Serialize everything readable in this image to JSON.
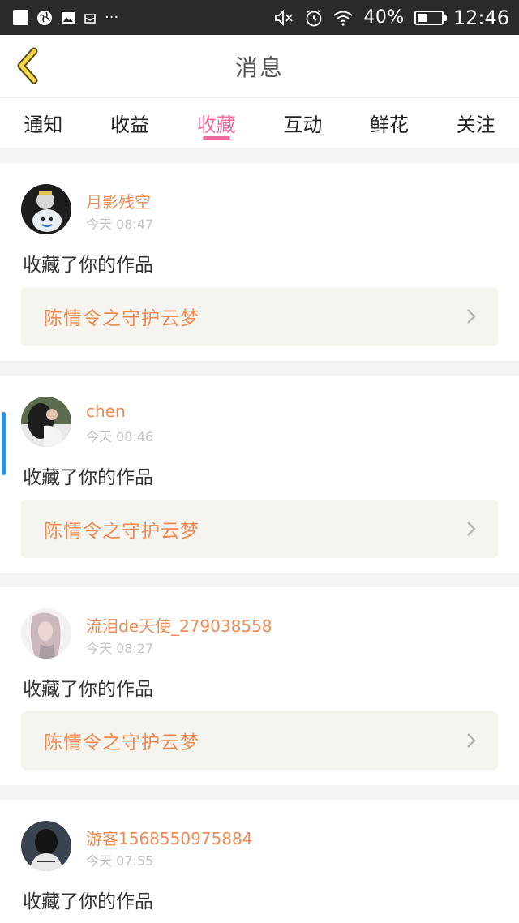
{
  "status_bar": {
    "battery_percent": "40%",
    "battery_level": 0.4,
    "time": "12:46",
    "icons": [
      "square-icon",
      "globe-icon",
      "image-icon",
      "mail-icon",
      "more-icon",
      "mute-icon",
      "alarm-icon",
      "wifi-icon",
      "battery-icon"
    ]
  },
  "nav": {
    "title": "消息"
  },
  "tabs": [
    {
      "label": "通知",
      "active": false
    },
    {
      "label": "收益",
      "active": false
    },
    {
      "label": "收藏",
      "active": true
    },
    {
      "label": "互动",
      "active": false
    },
    {
      "label": "鲜花",
      "active": false
    },
    {
      "label": "关注",
      "active": false
    }
  ],
  "messages": [
    {
      "username": "月影残空",
      "time": "今天 08:47",
      "text": "收藏了你的作品",
      "work_title": "陈情令之守护云梦"
    },
    {
      "username": "chen",
      "time": "今天 08:46",
      "text": "收藏了你的作品",
      "work_title": "陈情令之守护云梦"
    },
    {
      "username": "流泪de天使_279038558",
      "time": "今天 08:27",
      "text": "收藏了你的作品",
      "work_title": "陈情令之守护云梦"
    },
    {
      "username": "游客1568550975884",
      "time": "今天 07:55",
      "text": "收藏了你的作品"
    }
  ],
  "colors": {
    "accent_pink": "#ee6b9e",
    "name_orange": "#ee8a55",
    "statusbar": "#2a2a2a"
  }
}
